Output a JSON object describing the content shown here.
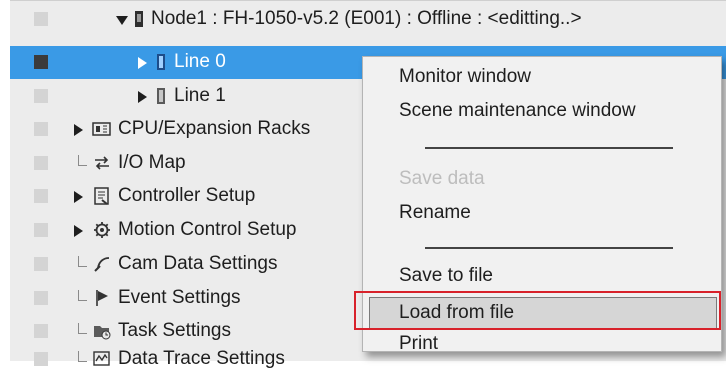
{
  "tree": {
    "node": "Node1 : FH-1050-v5.2 (E001) : Offline : <editting..>",
    "items": [
      {
        "label": "Line 0",
        "selected": true
      },
      {
        "label": "Line 1"
      },
      {
        "label": "CPU/Expansion Racks"
      },
      {
        "label": "I/O Map"
      },
      {
        "label": "Controller Setup"
      },
      {
        "label": "Motion Control Setup"
      },
      {
        "label": "Cam Data Settings"
      },
      {
        "label": "Event Settings"
      },
      {
        "label": "Task Settings"
      },
      {
        "label": "Data Trace Settings"
      }
    ]
  },
  "context_menu": {
    "items": [
      {
        "label": "Monitor window"
      },
      {
        "label": "Scene maintenance window"
      },
      {
        "label": "Save data",
        "disabled": true
      },
      {
        "label": "Rename"
      },
      {
        "label": "Save to file"
      },
      {
        "label": "Load from file",
        "highlighted": true
      },
      {
        "label": "Print"
      }
    ]
  },
  "colors": {
    "selection": "#3a9ae6",
    "callout": "#d8222b",
    "tree_background": "#ececec",
    "menu_background": "#f1f1f1"
  }
}
